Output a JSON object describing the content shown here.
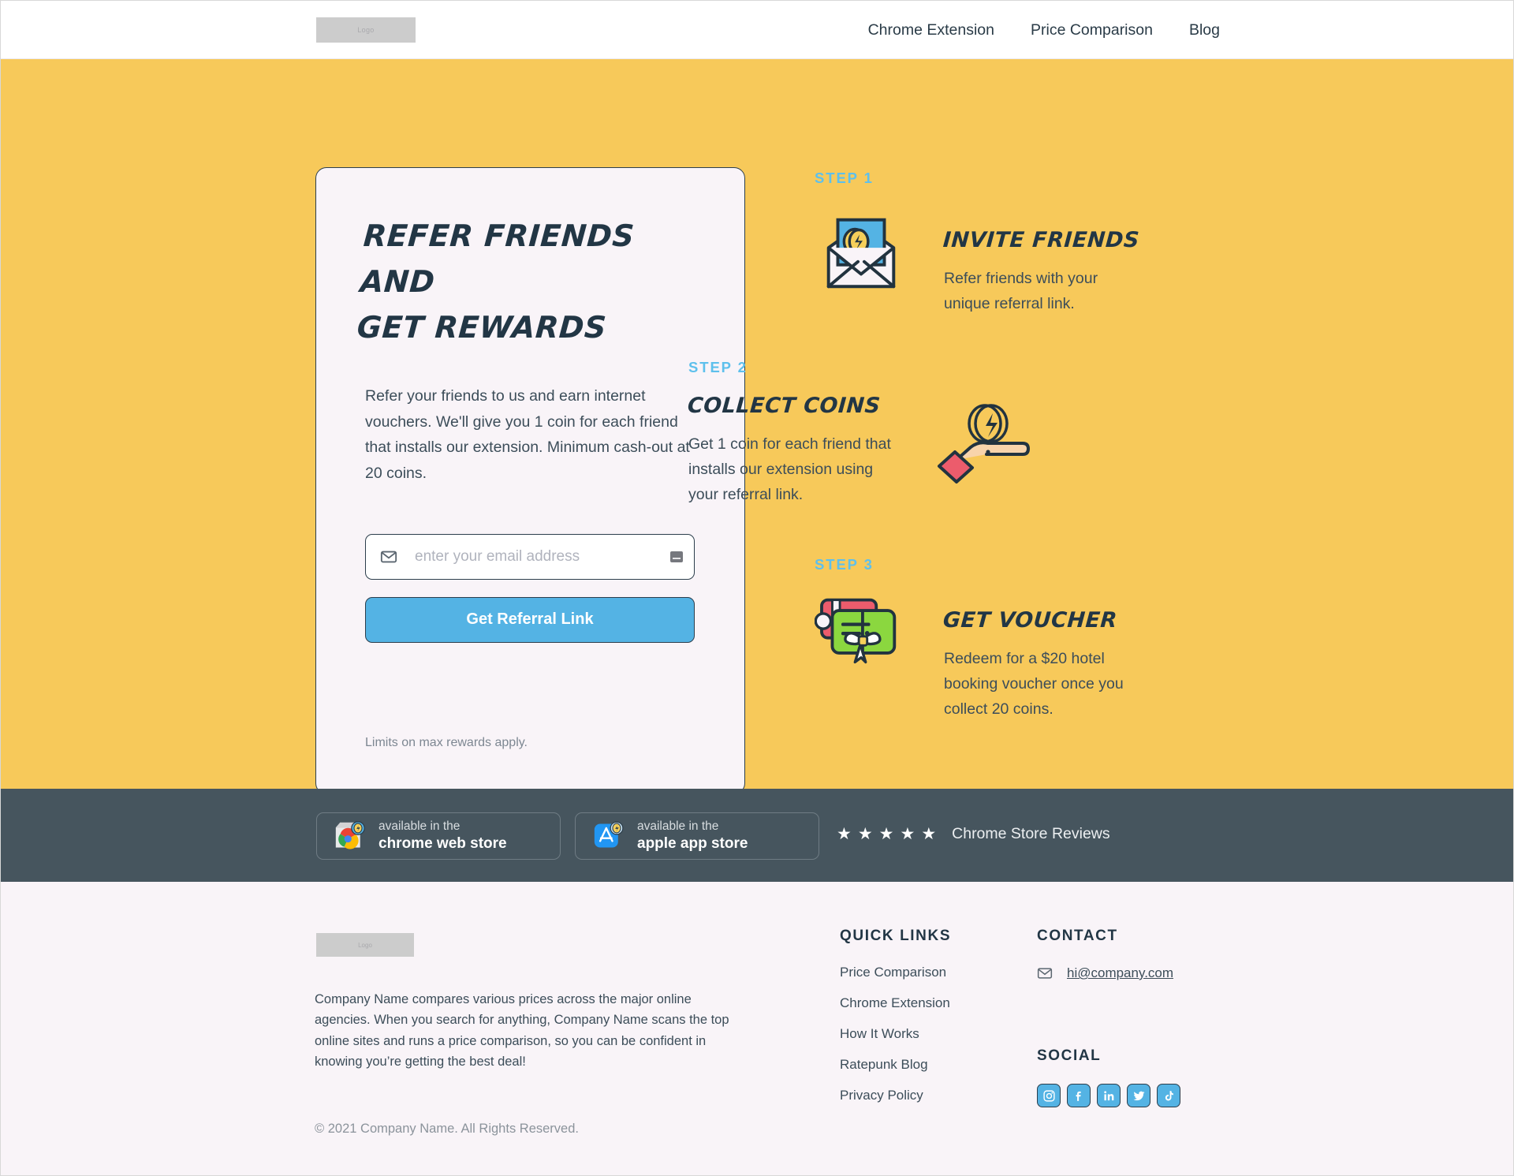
{
  "nav": {
    "logo_text": "Logo",
    "links": [
      {
        "label": "Chrome Extension"
      },
      {
        "label": "Price Comparison"
      },
      {
        "label": "Blog"
      }
    ]
  },
  "hero": {
    "card": {
      "title_line1": "Refer Friends and",
      "title_line2": "Get Rewards",
      "description": "Refer your friends to us and earn internet vouchers. We'll give you 1 coin for each friend that installs our extension. Minimum cash-out at 20 coins.",
      "email_placeholder": "enter your email address",
      "email_value": "",
      "email_icon": "envelope-icon",
      "autofill_icon": "autofill-icon",
      "cta_label": "Get Referral Link",
      "limits_note": "Limits on max rewards apply."
    },
    "steps": [
      {
        "step_label": "STEP 1",
        "heading": "Invite Friends",
        "body": "Refer friends with your unique referral link.",
        "icon": "envelope-coin-illustration"
      },
      {
        "step_label": "STEP 2",
        "heading": "Collect Coins",
        "body": "Get 1 coin for each friend that installs our extension using your referral link.",
        "icon": "hand-coin-illustration"
      },
      {
        "step_label": "STEP 3",
        "heading": "Get Voucher",
        "body": "Redeem for a $20 hotel booking voucher once you collect 20 coins.",
        "icon": "gift-voucher-illustration"
      }
    ]
  },
  "storebar": {
    "chrome_badge": {
      "small": "available in the",
      "big": "chrome web store",
      "icon": "chrome-store-icon"
    },
    "apple_badge": {
      "small": "available in the",
      "big": "apple app store",
      "icon": "apple-store-icon"
    },
    "reviews": {
      "stars": [
        "★",
        "★",
        "★",
        "★",
        "★"
      ],
      "star_count": 5,
      "label": "Chrome Store Reviews"
    }
  },
  "footer": {
    "logo_text": "Logo",
    "about": "Company Name compares various prices across the major online agencies. When you search for anything, Company Name scans the top online sites and runs a price comparison, so you can be confident in knowing you’re getting the best deal!",
    "copyright": "© 2021 Company Name. All Rights Reserved.",
    "quick_links": {
      "title": "QUICK LINKS",
      "items": [
        {
          "label": "Price Comparison"
        },
        {
          "label": "Chrome Extension"
        },
        {
          "label": "How It Works"
        },
        {
          "label": "Ratepunk Blog"
        },
        {
          "label": "Privacy Policy"
        }
      ]
    },
    "contact": {
      "title": "CONTACT",
      "email": "hi@company.com",
      "email_icon": "envelope-icon"
    },
    "social": {
      "title": "SOCIAL",
      "items": [
        {
          "name": "instagram-icon"
        },
        {
          "name": "facebook-icon"
        },
        {
          "name": "linkedin-icon"
        },
        {
          "name": "twitter-icon"
        },
        {
          "name": "tiktok-icon"
        }
      ]
    }
  },
  "colors": {
    "hero_bg": "#f7c95a",
    "card_bg": "#f9f4f8",
    "accent_blue": "#54b3e4",
    "step_label_blue": "#5ec0ec",
    "dark": "#223645",
    "storebar_bg": "#46555e",
    "coin_gold": "#f5cf5a",
    "voucher_green": "#8bd73f",
    "voucher_red": "#ee5f6b"
  }
}
